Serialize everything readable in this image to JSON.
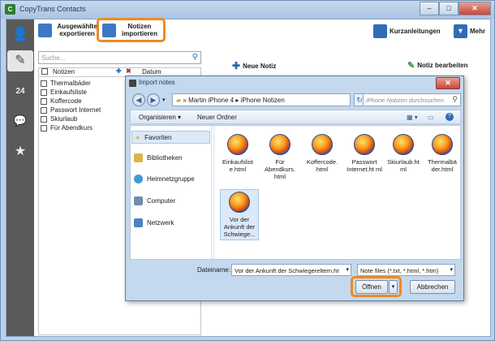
{
  "window": {
    "title": "CopyTrans Contacts",
    "minimize": "–",
    "maximize": "□",
    "close": "✕"
  },
  "sidebar": {
    "items": [
      {
        "icon": "contacts-icon",
        "glyph": "👤"
      },
      {
        "icon": "notes-icon",
        "glyph": "✎"
      },
      {
        "icon": "calendar-icon",
        "glyph": "24"
      },
      {
        "icon": "messages-icon",
        "glyph": "💬"
      },
      {
        "icon": "favorites-icon",
        "glyph": "★"
      }
    ]
  },
  "toolbar": {
    "export_label": "Ausgewählte exportieren",
    "import_label": "Notizen importieren",
    "help_label": "Kurzanleitungen",
    "more_label": "Mehr"
  },
  "notes_list": {
    "search_placeholder": "Suche...",
    "col_notes": "Notizen",
    "col_date": "Datum",
    "items": [
      "Thermalbäder",
      "Einkaufsliste",
      "Koffercode",
      "Passwort Internet",
      "Skiurlaub",
      "Für Abendkurs"
    ]
  },
  "actions": {
    "new_note": "Neue Notiz",
    "edit_note": "Notiz bearbeiten"
  },
  "dialog": {
    "title": "Import notes",
    "path": [
      "Martin iPhone 4",
      "iPhone Notizen"
    ],
    "search_placeholder": "iPhone Notizen durchsuchen",
    "organize": "Organisieren ▾",
    "new_folder": "Neuer Ordner",
    "nav": [
      "Favoriten",
      "Bibliotheken",
      "Heimnetzgruppe",
      "Computer",
      "Netzwerk"
    ],
    "files": [
      "Einkaufslist e.html",
      "Für Abendkurs. html",
      "Koffercode. html",
      "Passwort Internet.ht ml",
      "Skiurlaub.ht ml",
      "Thermalbä der.html",
      "Vor der Ankunft der Schwiege..."
    ],
    "filename_label": "Dateiname:",
    "filename_value": "Vor der Ankunft der Schwiegereltern.ht",
    "filetype_value": "Note files (*.txt, *.html, *.htm)",
    "open_label": "Öffnen",
    "cancel_label": "Abbrechen"
  },
  "colors": {
    "highlight": "#f08a1e",
    "sidebar": "#5a5a5a",
    "accent": "#2a6ab8"
  }
}
